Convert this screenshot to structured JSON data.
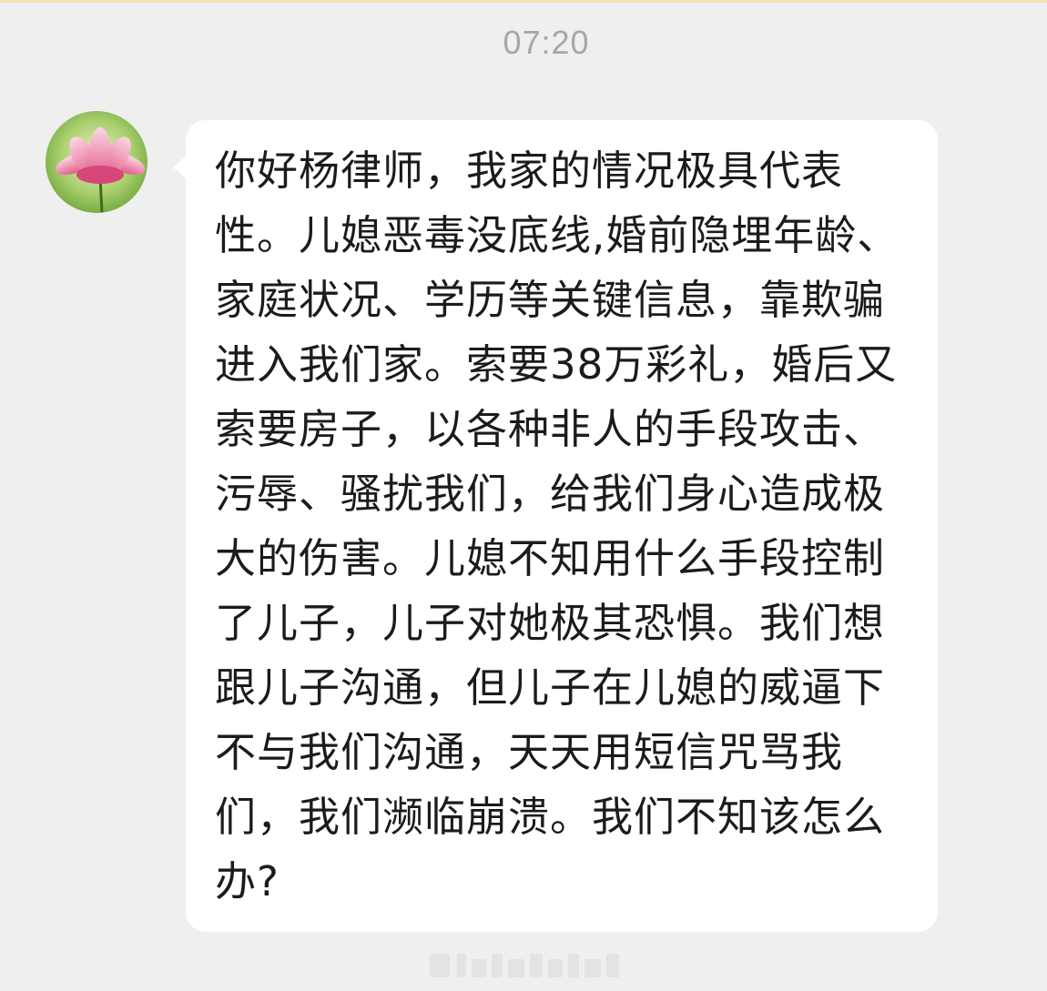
{
  "chat": {
    "timestamp": "07:20",
    "message": {
      "sender_avatar_icon": "lotus-flower-avatar",
      "text": "你好杨律师，我家的情况极具代表性。儿媳恶毒没底线,婚前隐埋年龄、家庭状况、学历等关键信息，靠欺骗进入我们家。索要38万彩礼，婚后又索要房子，以各种非人的手段攻击、污辱、骚扰我们，给我们身心造成极大的伤害。儿媳不知用什么手段控制了儿子，儿子对她极其恐惧。我们想跟儿子沟通，但儿子在儿媳的威逼下不与我们沟通，天天用短信咒骂我们，我们濒临崩溃。我们不知该怎么办?"
    }
  },
  "colors": {
    "background": "#efefef",
    "bubble": "#ffffff",
    "text": "#1b1b1b",
    "timestamp": "#a6a6a6"
  }
}
